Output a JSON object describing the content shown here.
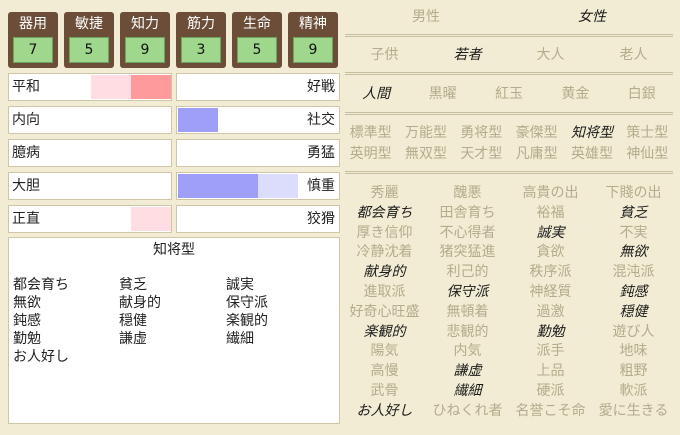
{
  "stats": [
    {
      "label": "器用",
      "value": "7"
    },
    {
      "label": "敏捷",
      "value": "5"
    },
    {
      "label": "知力",
      "value": "9"
    },
    {
      "label": "筋力",
      "value": "3"
    },
    {
      "label": "生命",
      "value": "5"
    },
    {
      "label": "精神",
      "value": "9"
    }
  ],
  "traits": [
    {
      "left": "平和",
      "right": "好戦"
    },
    {
      "left": "内向",
      "right": "社交"
    },
    {
      "left": "臆病",
      "right": "勇猛"
    },
    {
      "left": "大胆",
      "right": "慎重"
    },
    {
      "left": "正直",
      "right": "狡猾"
    }
  ],
  "colors": {
    "pink_light": "#ffdde2",
    "pink_strong": "#ff9a9c",
    "blue_strong": "#9f9ff9",
    "blue_light": "#dcdcfc"
  },
  "info": {
    "title": "知将型",
    "traits": [
      "都会育ち",
      "貧乏",
      "誠実",
      "無欲",
      "献身的",
      "保守派",
      "鈍感",
      "穏健",
      "楽観的",
      "勤勉",
      "謙虚",
      "繊細",
      "お人好し"
    ]
  },
  "gender": [
    {
      "label": "男性",
      "selected": false
    },
    {
      "label": "女性",
      "selected": true
    }
  ],
  "age": [
    {
      "label": "子供",
      "selected": false
    },
    {
      "label": "若者",
      "selected": true
    },
    {
      "label": "大人",
      "selected": false
    },
    {
      "label": "老人",
      "selected": false
    }
  ],
  "race": [
    {
      "label": "人間",
      "selected": true
    },
    {
      "label": "黒曜",
      "selected": false
    },
    {
      "label": "紅玉",
      "selected": false
    },
    {
      "label": "黄金",
      "selected": false
    },
    {
      "label": "白銀",
      "selected": false
    }
  ],
  "types": [
    {
      "label": "標準型",
      "selected": false
    },
    {
      "label": "万能型",
      "selected": false
    },
    {
      "label": "勇将型",
      "selected": false
    },
    {
      "label": "豪傑型",
      "selected": false
    },
    {
      "label": "知将型",
      "selected": true
    },
    {
      "label": "策士型",
      "selected": false
    },
    {
      "label": "英明型",
      "selected": false
    },
    {
      "label": "無双型",
      "selected": false
    },
    {
      "label": "天才型",
      "selected": false
    },
    {
      "label": "凡庸型",
      "selected": false
    },
    {
      "label": "英雄型",
      "selected": false
    },
    {
      "label": "神仙型",
      "selected": false
    }
  ],
  "attributes": [
    {
      "label": "秀麗",
      "selected": false
    },
    {
      "label": "醜悪",
      "selected": false
    },
    {
      "label": "高貴の出",
      "selected": false
    },
    {
      "label": "下賤の出",
      "selected": false
    },
    {
      "label": "都会育ち",
      "selected": true
    },
    {
      "label": "田舎育ち",
      "selected": false
    },
    {
      "label": "裕福",
      "selected": false
    },
    {
      "label": "貧乏",
      "selected": true
    },
    {
      "label": "厚き信仰",
      "selected": false
    },
    {
      "label": "不心得者",
      "selected": false
    },
    {
      "label": "誠実",
      "selected": true
    },
    {
      "label": "不実",
      "selected": false
    },
    {
      "label": "冷静沈着",
      "selected": false
    },
    {
      "label": "猪突猛進",
      "selected": false
    },
    {
      "label": "貪欲",
      "selected": false
    },
    {
      "label": "無欲",
      "selected": true
    },
    {
      "label": "献身的",
      "selected": true
    },
    {
      "label": "利己的",
      "selected": false
    },
    {
      "label": "秩序派",
      "selected": false
    },
    {
      "label": "混沌派",
      "selected": false
    },
    {
      "label": "進取派",
      "selected": false
    },
    {
      "label": "保守派",
      "selected": true
    },
    {
      "label": "神経質",
      "selected": false
    },
    {
      "label": "鈍感",
      "selected": true
    },
    {
      "label": "好奇心旺盛",
      "selected": false
    },
    {
      "label": "無頓着",
      "selected": false
    },
    {
      "label": "過激",
      "selected": false
    },
    {
      "label": "穏健",
      "selected": true
    },
    {
      "label": "楽観的",
      "selected": true
    },
    {
      "label": "悲観的",
      "selected": false
    },
    {
      "label": "勤勉",
      "selected": true
    },
    {
      "label": "遊び人",
      "selected": false
    },
    {
      "label": "陽気",
      "selected": false
    },
    {
      "label": "内気",
      "selected": false
    },
    {
      "label": "派手",
      "selected": false
    },
    {
      "label": "地味",
      "selected": false
    },
    {
      "label": "高慢",
      "selected": false
    },
    {
      "label": "謙虚",
      "selected": true
    },
    {
      "label": "上品",
      "selected": false
    },
    {
      "label": "粗野",
      "selected": false
    },
    {
      "label": "武骨",
      "selected": false
    },
    {
      "label": "繊細",
      "selected": true
    },
    {
      "label": "硬派",
      "selected": false
    },
    {
      "label": "軟派",
      "selected": false
    },
    {
      "label": "お人好し",
      "selected": true
    },
    {
      "label": "ひねくれ者",
      "selected": false
    },
    {
      "label": "名誉こそ命",
      "selected": false
    },
    {
      "label": "愛に生きる",
      "selected": false
    }
  ]
}
